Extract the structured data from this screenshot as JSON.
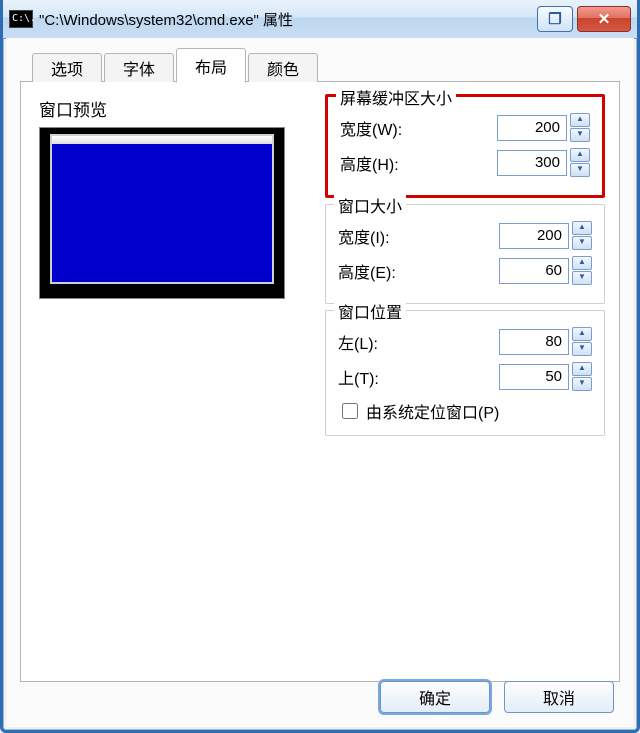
{
  "titlebar": {
    "icon_text": "C:\\.",
    "title": "\"C:\\Windows\\system32\\cmd.exe\" 属性",
    "help_glyph": "❐",
    "close_glyph": "✕"
  },
  "tabs": {
    "options": "选项",
    "font": "字体",
    "layout": "布局",
    "color": "颜色",
    "active": "layout"
  },
  "preview": {
    "label": "窗口预览"
  },
  "groups": {
    "buffer": {
      "legend": "屏幕缓冲区大小",
      "width_label": "宽度(W):",
      "height_label": "高度(H):",
      "width_value": "200",
      "height_value": "300"
    },
    "window_size": {
      "legend": "窗口大小",
      "width_label": "宽度(I):",
      "height_label": "高度(E):",
      "width_value": "200",
      "height_value": "60"
    },
    "window_pos": {
      "legend": "窗口位置",
      "left_label": "左(L):",
      "top_label": "上(T):",
      "left_value": "80",
      "top_value": "50",
      "auto_label": "由系统定位窗口(P)",
      "auto_checked": false
    }
  },
  "buttons": {
    "ok": "确定",
    "cancel": "取消"
  },
  "spin_glyphs": {
    "up": "▲",
    "down": "▼"
  }
}
